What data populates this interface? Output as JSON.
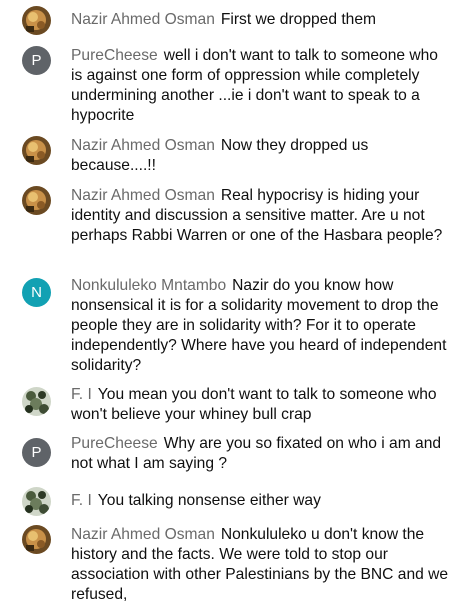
{
  "chat": {
    "messages": [
      {
        "author": "Nazir Ahmed Osman",
        "avatar": "photo-nazir",
        "text": "First we dropped them"
      },
      {
        "author": "PureCheese",
        "avatar": "letter",
        "letter": "P",
        "avatar_color": "#5f6368",
        "text": "well i don't want to talk to someone who is against one form of oppression while completely undermining another ...ie i don't want to speak to a hypocrite"
      },
      {
        "author": "Nazir Ahmed Osman",
        "avatar": "photo-nazir",
        "text": "Now they dropped us because....!!"
      },
      {
        "author": "Nazir Ahmed Osman",
        "avatar": "photo-nazir",
        "text": "Real hypocrisy is hiding your identity and discussion a sensitive matter. Are u not perhaps Rabbi Warren or one of the Hasbara people?"
      },
      {
        "author": "Nonkululeko Mntambo",
        "avatar": "letter",
        "letter": "N",
        "avatar_color": "#12a1b3",
        "text": "Nazir do you know how nonsensical it is for a solidarity movement to drop the people they are in solidarity with? For it to operate independently? Where have you heard of independent solidarity?"
      },
      {
        "author": "F. I",
        "avatar": "photo-fi",
        "text": "You mean you don't want to talk to someone who won't believe your whiney bull crap"
      },
      {
        "author": "PureCheese",
        "avatar": "letter",
        "letter": "P",
        "avatar_color": "#5f6368",
        "text": "Why are you so fixated on who i am and not what I am saying ?"
      },
      {
        "author": "F. I",
        "avatar": "photo-fi",
        "text": "You talking nonsense either way"
      },
      {
        "author": "Nazir Ahmed Osman",
        "avatar": "photo-nazir",
        "text": "Nonkululeko u don't know the history and the facts. We were told to stop our association with other Palestinians by the BNC and we refused,"
      }
    ]
  }
}
